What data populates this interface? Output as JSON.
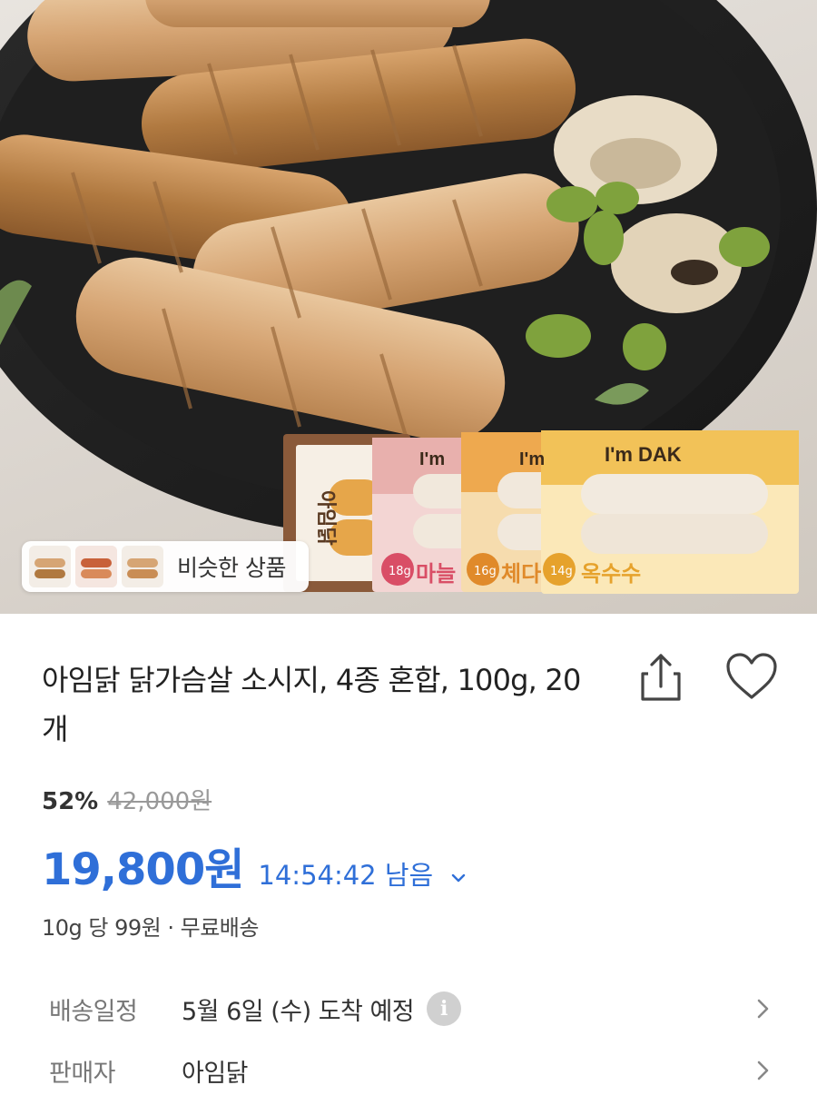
{
  "hero": {
    "similar_label": "비슷한 상품",
    "package_brand": "I'm DAK",
    "flavors": [
      "마늘",
      "체다",
      "옥수수"
    ],
    "protein_badges": [
      "18g",
      "16g",
      "14g"
    ],
    "side_brand": "아임닭"
  },
  "product": {
    "title": "아임닭 닭가슴살 소시지, 4종 혼합, 100g, 20개",
    "discount_pct": "52%",
    "original_price": "42,000원",
    "price": "19,800원",
    "timer": "14:54:42 남음",
    "unit_info": "10g 당 99원 · 무료배송"
  },
  "info": {
    "delivery_label": "배송일정",
    "delivery_value": "5월 6일 (수) 도착 예정",
    "seller_label": "판매자",
    "seller_value": "아임닭"
  },
  "icons": {
    "share": "share-icon",
    "heart": "heart-icon",
    "info": "info-icon",
    "chevron": "chevron-right-icon"
  },
  "colors": {
    "price_blue": "#2f6fd8",
    "muted": "#999999"
  }
}
